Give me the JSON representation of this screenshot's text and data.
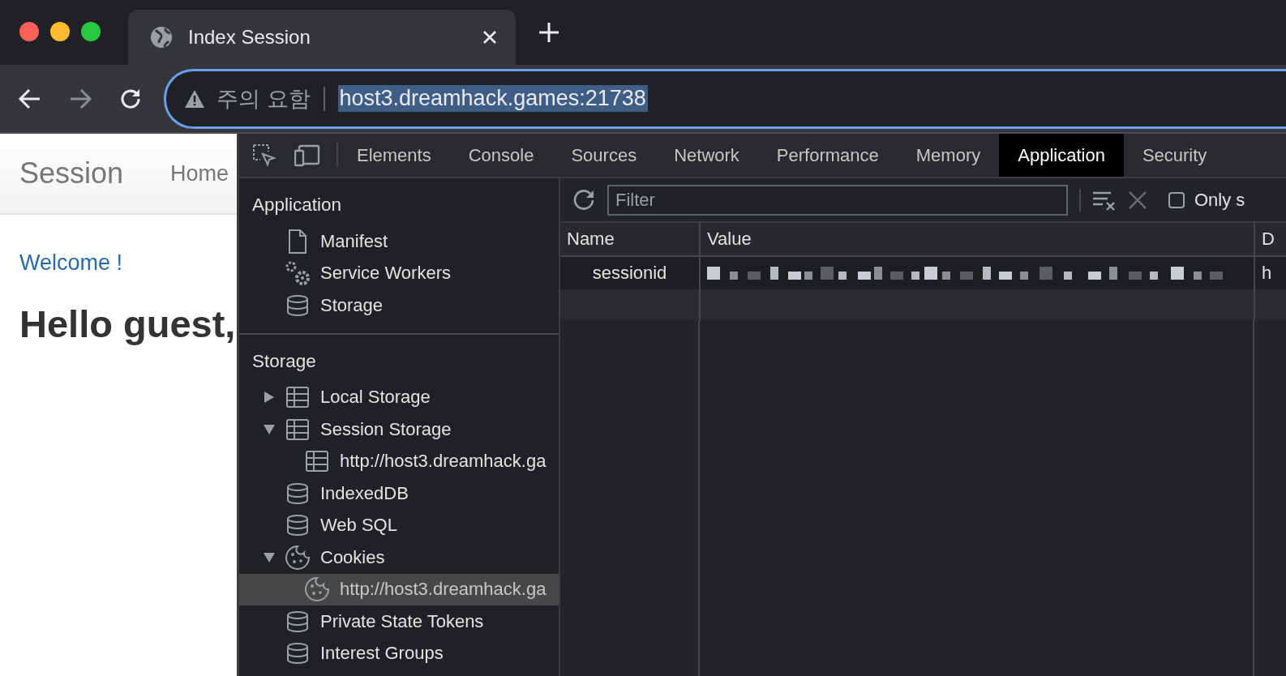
{
  "browser": {
    "tabs": [
      {
        "title": "Index Session",
        "selected": true
      }
    ],
    "address_bar": {
      "warning": "주의 요함",
      "url": "host3.dreamhack.games:21738",
      "url_selected": true
    }
  },
  "page": {
    "brand": "Session",
    "nav": [
      "Home"
    ],
    "welcome": "Welcome !",
    "heading": "Hello guest,"
  },
  "devtools": {
    "tabs": [
      {
        "label": "Elements",
        "selected": false
      },
      {
        "label": "Console",
        "selected": false
      },
      {
        "label": "Sources",
        "selected": false
      },
      {
        "label": "Network",
        "selected": false
      },
      {
        "label": "Performance",
        "selected": false
      },
      {
        "label": "Memory",
        "selected": false
      },
      {
        "label": "Application",
        "selected": true
      },
      {
        "label": "Security",
        "selected": false
      }
    ],
    "sidebar": {
      "sections": [
        {
          "title": "Application",
          "items": [
            {
              "label": "Manifest",
              "kind": "file",
              "selected": false
            },
            {
              "label": "Service Workers",
              "kind": "gears",
              "selected": false
            },
            {
              "label": "Storage",
              "kind": "database",
              "selected": false
            }
          ]
        },
        {
          "title": "Storage",
          "items": [
            {
              "label": "Local Storage",
              "kind": "table",
              "selected": false,
              "expanded": false
            },
            {
              "label": "Session Storage",
              "kind": "table",
              "selected": false,
              "expanded": true,
              "children": [
                {
                  "label": "http://host3.dreamhack.ga",
                  "kind": "table",
                  "selected": false
                }
              ]
            },
            {
              "label": "IndexedDB",
              "kind": "database",
              "selected": false
            },
            {
              "label": "Web SQL",
              "kind": "database",
              "selected": false
            },
            {
              "label": "Cookies",
              "kind": "cookie",
              "selected": false,
              "expanded": true,
              "children": [
                {
                  "label": "http://host3.dreamhack.ga",
                  "kind": "cookie",
                  "selected": true
                }
              ]
            },
            {
              "label": "Private State Tokens",
              "kind": "database",
              "selected": false
            },
            {
              "label": "Interest Groups",
              "kind": "database",
              "selected": false
            }
          ]
        }
      ]
    },
    "filter": {
      "placeholder": "Filter"
    },
    "only_checkbox": {
      "label": "Only s",
      "checked": false
    },
    "table": {
      "columns": [
        "Name",
        "Value",
        "D"
      ],
      "rows": [
        {
          "name": "sessionid",
          "value": {
            "kind": "redacted"
          },
          "column_3": "h"
        }
      ]
    }
  }
}
